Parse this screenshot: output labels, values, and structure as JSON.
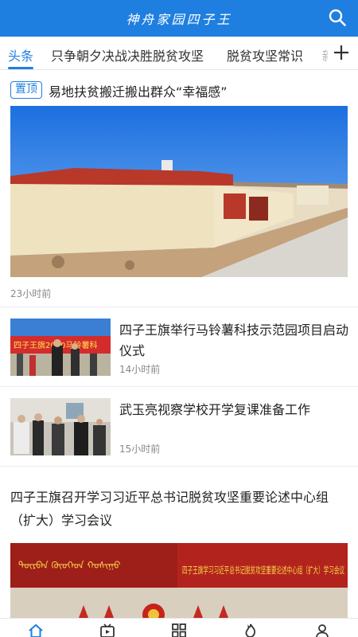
{
  "header": {
    "title": "神舟家园四子王"
  },
  "tabs": {
    "items": [
      {
        "label": "头条",
        "active": true
      },
      {
        "label": "只争朝夕决战决胜脱贫攻坚",
        "active": false
      },
      {
        "label": "脱贫攻坚常识",
        "active": false
      },
      {
        "label": "新",
        "active": false
      }
    ]
  },
  "feed": {
    "top_item": {
      "badge": "置顶",
      "title": "易地扶贫搬迁搬出群众“幸福感”",
      "time": "23小时前"
    },
    "items": [
      {
        "title": "四子王旗举行马铃薯科技示范园项目启动仪式",
        "time": "14小时前",
        "banner_text": "四子王旗2020马铃薯科"
      },
      {
        "title": "武玉亮视察学校开学复课准备工作",
        "time": "15小时前"
      }
    ],
    "big_item": {
      "title": "四子王旗召开学习习近平总书记脱贫攻坚重要论述中心组（扩大）学习会议",
      "banner_text": "四子王旗学习习近平总书记脱贫攻坚重要论述中心组（扩大）学习会议"
    }
  },
  "tabbar": {
    "items": [
      {
        "icon": "home-icon",
        "active": true
      },
      {
        "icon": "video-icon",
        "active": false
      },
      {
        "icon": "grid-icon",
        "active": false
      },
      {
        "icon": "flame-icon",
        "active": false
      },
      {
        "icon": "user-icon",
        "active": false
      }
    ]
  },
  "colors": {
    "accent": "#1f7fe0",
    "meta_text": "#888888"
  }
}
